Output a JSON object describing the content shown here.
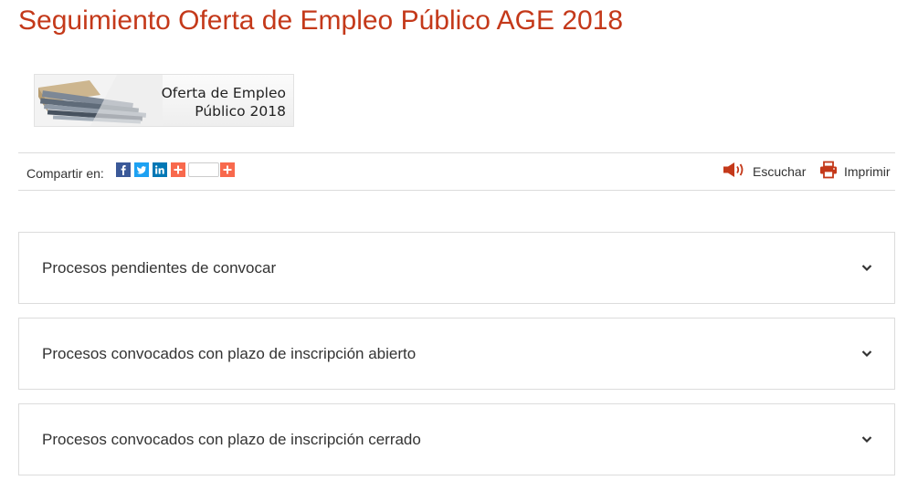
{
  "header": {
    "title": "Seguimiento Oferta de Empleo Público AGE 2018"
  },
  "banner": {
    "line1": "Oferta de Empleo",
    "line2": "Público 2018"
  },
  "share": {
    "label": "Compartir en:",
    "networks": [
      "facebook-icon",
      "twitter-icon",
      "linkedin-icon",
      "addthis-icon",
      "more-share-icon"
    ]
  },
  "tools": {
    "listen_label": "Escuchar",
    "print_label": "Imprimir"
  },
  "accordions": [
    {
      "title": "Procesos pendientes de convocar"
    },
    {
      "title": "Procesos convocados con plazo de inscripción abierto"
    },
    {
      "title": "Procesos convocados con plazo de inscripción cerrado"
    }
  ],
  "colors": {
    "accent": "#c4391a",
    "facebook": "#3b5998",
    "twitter": "#1da1f2",
    "linkedin": "#0077b5",
    "addthis": "#f8694d"
  }
}
